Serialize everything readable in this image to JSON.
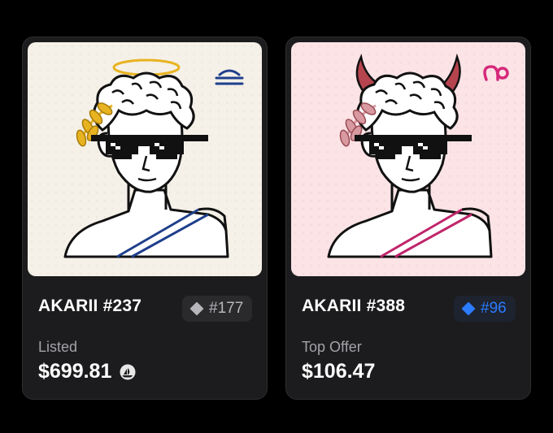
{
  "cards": [
    {
      "name": "AKARII #237",
      "rank": "#177",
      "price_label": "Listed",
      "price": "$699.81",
      "rank_color": "#b7b7bb",
      "art_bg": "#f5f1e8",
      "halo_color": "#e8b321",
      "laurel_color": "#e8b321",
      "drape_color": "#1f3f8c",
      "badge_icon": "libra-symbol-icon",
      "badge_color": "#1f3f8c"
    },
    {
      "name": "AKARII #388",
      "rank": "#96",
      "price_label": "Top Offer",
      "price": "$106.47",
      "rank_color": "#2b7cff",
      "art_bg": "#fbe3e6",
      "horn_color": "#b5444e",
      "laurel_color": "#d89aa0",
      "drape_color": "#c0256b",
      "badge_icon": "capricorn-symbol-icon",
      "badge_color": "#d6287a"
    }
  ]
}
